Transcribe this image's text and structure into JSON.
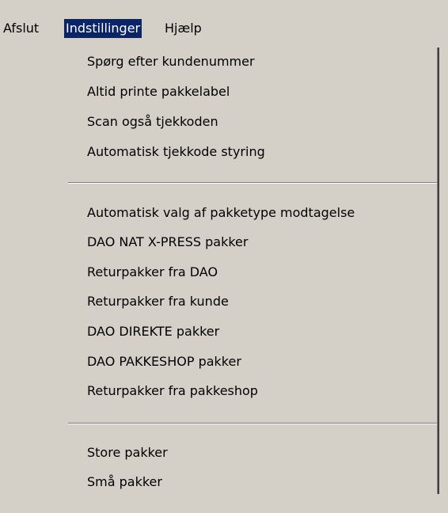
{
  "menubar": {
    "items": [
      "Afslut",
      "Indstillinger",
      "Hjælp"
    ]
  },
  "dropdown": {
    "group1": [
      "Spørg efter kundenummer",
      "Altid printe pakkelabel",
      "Scan også tjekkoden",
      "Automatisk tjekkode styring"
    ],
    "group2": [
      "Automatisk valg af pakketype modtagelse",
      "DAO NAT X-PRESS pakker",
      "Returpakker fra DAO",
      "Returpakker fra kunde",
      "DAO DIREKTE pakker",
      "DAO PAKKESHOP pakker",
      "Returpakker fra pakkeshop"
    ],
    "group3": [
      "Store pakker",
      "Små pakker"
    ]
  },
  "colors": {
    "background": "#d4d0c8",
    "highlight": "#0a246a",
    "highlight_text": "#ffffff",
    "separator_dark": "#808080",
    "separator_light": "#ffffff"
  }
}
